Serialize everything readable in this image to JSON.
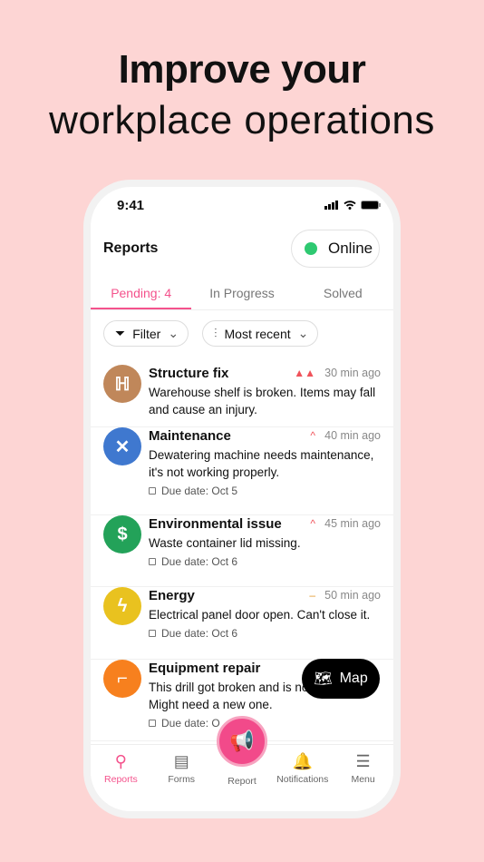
{
  "headline": {
    "line1": "Improve your",
    "line2": "workplace operations"
  },
  "status_bar": {
    "time": "9:41"
  },
  "header": {
    "title": "Reports",
    "status": "Online",
    "status_color": "#2ec971"
  },
  "tabs": [
    {
      "label": "Pending: 4",
      "active": true
    },
    {
      "label": "In Progress"
    },
    {
      "label": "Solved"
    }
  ],
  "filters": {
    "filter": "Filter",
    "sort": "Most recent"
  },
  "items": [
    {
      "title": "Structure fix",
      "priority_icon": "double-chevron-up",
      "priority": "▲▲",
      "time": "30 min ago",
      "desc": "Warehouse shelf is broken. Items may fall and cause an injury.",
      "due": "",
      "color": "#c0875a",
      "icon": "ladder-icon",
      "glyph": "ℍ"
    },
    {
      "title": "Maintenance",
      "priority_icon": "chevron-up",
      "priority": "^",
      "time": "40 min ago",
      "desc": "Dewatering machine needs maintenance, it's not working properly.",
      "due": "Due date: Oct 5",
      "color": "#3f78cf",
      "icon": "tools-icon",
      "glyph": "✕"
    },
    {
      "title": "Environmental issue",
      "priority_icon": "chevron-up",
      "priority": "^",
      "time": "45 min ago",
      "desc": "Waste container lid missing.",
      "due": "Due date: Oct 6",
      "color": "#23a259",
      "icon": "barrel-icon",
      "glyph": "$"
    },
    {
      "title": "Energy",
      "priority_icon": "dash",
      "priority": "–",
      "time": "50 min ago",
      "desc": "Electrical panel door open. Can't close it.",
      "due": "Due date: Oct 6",
      "color": "#e9c21f",
      "icon": "lightning-icon",
      "glyph": "ϟ"
    },
    {
      "title": "Equipment repair",
      "priority_icon": "",
      "priority": "",
      "time": "",
      "desc": "This drill got broken and is not working. Might need a new one.",
      "due": "Due date: O",
      "color": "#f7801e",
      "icon": "drill-icon",
      "glyph": "⌐"
    }
  ],
  "map_button": "Map",
  "nav": [
    {
      "label": "Reports",
      "icon": "location-pin-icon",
      "glyph": "⚲"
    },
    {
      "label": "Forms",
      "icon": "document-icon",
      "glyph": "▤"
    },
    {
      "label": "Report",
      "icon": "megaphone-icon",
      "glyph": "📢"
    },
    {
      "label": "Notifications",
      "icon": "bell-icon",
      "glyph": "🔔"
    },
    {
      "label": "Menu",
      "icon": "hamburger-icon",
      "glyph": "☰"
    }
  ],
  "accent": "#f4528c"
}
